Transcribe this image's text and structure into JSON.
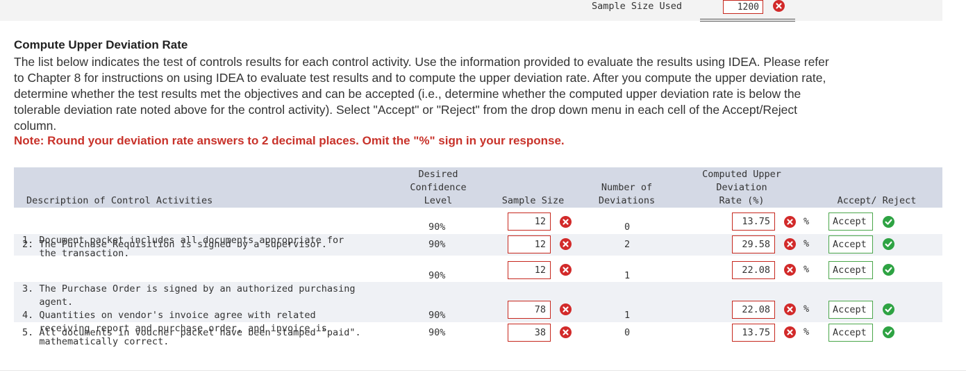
{
  "top": {
    "sample_size_label": "Sample Size Used",
    "sample_size_value": "1200"
  },
  "heading": "Compute Upper Deviation Rate",
  "paragraph": "The list below indicates the test of controls results for each control activity. Use the information provided to evaluate the results using IDEA. Please refer to Chapter 8 for instructions on using IDEA to evaluate test results and to compute the upper deviation rate. After you compute the upper deviation rate, determine whether the test results met the objectives and can be accepted (i.e., determine whether the computed upper deviation rate is below the tolerable deviation rate noted above for the control activity). Select \"Accept\" or \"Reject\" from the drop down menu in each cell of the Accept/Reject column.",
  "note": "Note: Round your deviation rate answers to 2 decimal places. Omit the \"%\" sign in your response.",
  "table": {
    "headers": {
      "description": "Description of Control Activities",
      "confidence": [
        "Desired",
        "Confidence",
        "Level"
      ],
      "sample_size": "Sample Size",
      "deviations": [
        "Number of",
        "Deviations"
      ],
      "rate": [
        "Computed Upper",
        "Deviation",
        "Rate (%)"
      ],
      "accept_reject": "Accept/ Reject"
    },
    "rows": [
      {
        "desc": [
          "1. Document packet includes all documents appropriate for",
          "   the transaction."
        ],
        "confidence": "90%",
        "sample_size": "12",
        "deviations": "0",
        "rate": "13.75",
        "pct": "%",
        "decision": "Accept"
      },
      {
        "desc": [
          "2. The Purchase Requisition is signed by a supervisor."
        ],
        "confidence": "90%",
        "sample_size": "12",
        "deviations": "2",
        "rate": "29.58",
        "pct": "%",
        "decision": "Accept"
      },
      {
        "desc": [
          "3. The Purchase Order is signed by an authorized purchasing",
          "   agent."
        ],
        "confidence": "90%",
        "sample_size": "12",
        "deviations": "1",
        "rate": "22.08",
        "pct": "%",
        "decision": "Accept"
      },
      {
        "desc": [
          "4. Quantities on vendor's invoice agree with related",
          "   receiving report and purchase order, and invoice is",
          "   mathematically correct."
        ],
        "confidence": "90%",
        "sample_size": "78",
        "deviations": "1",
        "rate": "22.08",
        "pct": "%",
        "decision": "Accept"
      },
      {
        "desc": [
          "5. All documents in voucher packet have been stamped \"paid\"."
        ],
        "confidence": "90%",
        "sample_size": "38",
        "deviations": "0",
        "rate": "13.75",
        "pct": "%",
        "decision": "Accept"
      }
    ]
  },
  "icons": {
    "incorrect": "x-circle-icon",
    "correct": "check-circle-icon"
  },
  "colors": {
    "incorrect": "#d22a2a",
    "correct": "#2ea343",
    "note": "#c8322a",
    "header_bg": "#d4d9e5"
  }
}
